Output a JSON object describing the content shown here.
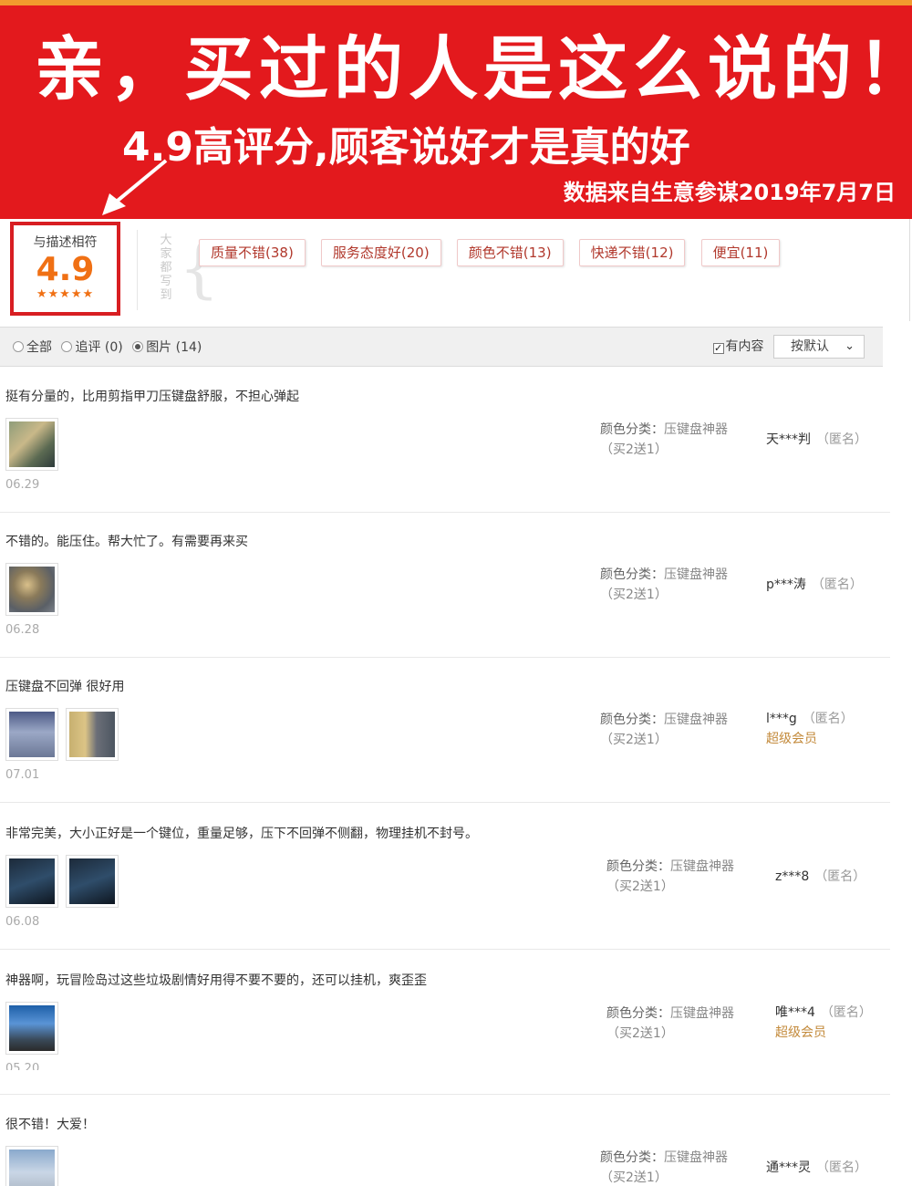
{
  "banner": {
    "headline": "亲，买过的人是这么说的！",
    "subline": "4.9高评分,顾客说好才是真的好",
    "source": "数据来自生意参谋2019年7月7日"
  },
  "rating": {
    "label": "与描述相符",
    "score": "4.9",
    "stars": "★★★★★",
    "caption": "大家都写到",
    "tags": [
      "质量不错(38)",
      "服务态度好(20)",
      "颜色不错(13)",
      "快递不错(12)",
      "便宜(11)"
    ]
  },
  "filter": {
    "all": "全部",
    "followup": "追评 (0)",
    "pictures": "图片 (14)",
    "has_content": "有内容",
    "sort": "按默认"
  },
  "reviews": [
    {
      "text": "挺有分量的，比用剪指甲刀压键盘舒服，不担心弹起",
      "date": "06.29",
      "sku_key": "颜色分类：",
      "sku_val": "压键盘神器",
      "sku_extra": "（买2送1）",
      "user": "天***判",
      "anon": "（匿名）",
      "vip": ""
    },
    {
      "text": "不错的。能压住。帮大忙了。有需要再来买",
      "date": "06.28",
      "sku_key": "颜色分类：",
      "sku_val": "压键盘神器",
      "sku_extra": "（买2送1）",
      "user": "p***涛",
      "anon": "（匿名）",
      "vip": ""
    },
    {
      "text": "压键盘不回弹 很好用",
      "date": "07.01",
      "sku_key": "颜色分类：",
      "sku_val": "压键盘神器",
      "sku_extra": "（买2送1）",
      "user": "l***g",
      "anon": "（匿名）",
      "vip": "超级会员"
    },
    {
      "text": "非常完美，大小正好是一个键位，重量足够，压下不回弹不侧翻，物理挂机不封号。",
      "date": "06.08",
      "sku_key": "颜色分类：",
      "sku_val": "压键盘神器",
      "sku_extra": "（买2送1）",
      "user": "z***8",
      "anon": "（匿名）",
      "vip": ""
    },
    {
      "text": "神器啊，玩冒险岛过这些垃圾剧情好用得不要不要的，还可以挂机，爽歪歪",
      "date": "05.20",
      "sku_key": "颜色分类：",
      "sku_val": "压键盘神器",
      "sku_extra": "（买2送1）",
      "user": "唯***4",
      "anon": "（匿名）",
      "vip": "超级会员"
    },
    {
      "text": "很不错！大爱！",
      "date": "",
      "sku_key": "颜色分类：",
      "sku_val": "压键盘神器",
      "sku_extra": "（买2送1）",
      "user": "通***灵",
      "anon": "（匿名）",
      "vip": ""
    }
  ],
  "colors": {
    "banner_red": "#e3191d",
    "score_orange": "#f07014",
    "tag_text": "#b1382c",
    "vip_gold": "#c38a3b"
  }
}
